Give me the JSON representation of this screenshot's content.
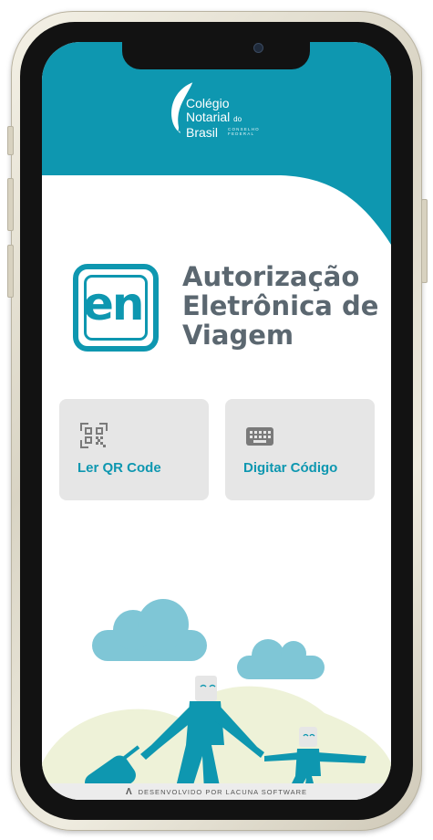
{
  "colors": {
    "brand": "#0e97b0",
    "title_gray": "#5b6770",
    "card_bg": "#e6e6e6",
    "cloud": "#7fc6d6",
    "ground": "#eef2d8"
  },
  "header": {
    "logo_line1": "Colégio",
    "logo_line2": "Notarial",
    "logo_line2_suffix": "do",
    "logo_line3": "Brasil",
    "logo_subtitle_1": "CONSELHO",
    "logo_subtitle_2": "FEDERAL"
  },
  "app": {
    "logo_text": "en",
    "title_line1": "Autorização",
    "title_line2": "Eletrônica de",
    "title_line3": "Viagem"
  },
  "actions": {
    "qr": {
      "label": "Ler QR Code",
      "icon": "qr-code-icon"
    },
    "code": {
      "label": "Digitar Código",
      "icon": "keyboard-icon"
    }
  },
  "footer": {
    "mark": "Λ",
    "text": "DESENVOLVIDO POR LACUNA SOFTWARE"
  }
}
